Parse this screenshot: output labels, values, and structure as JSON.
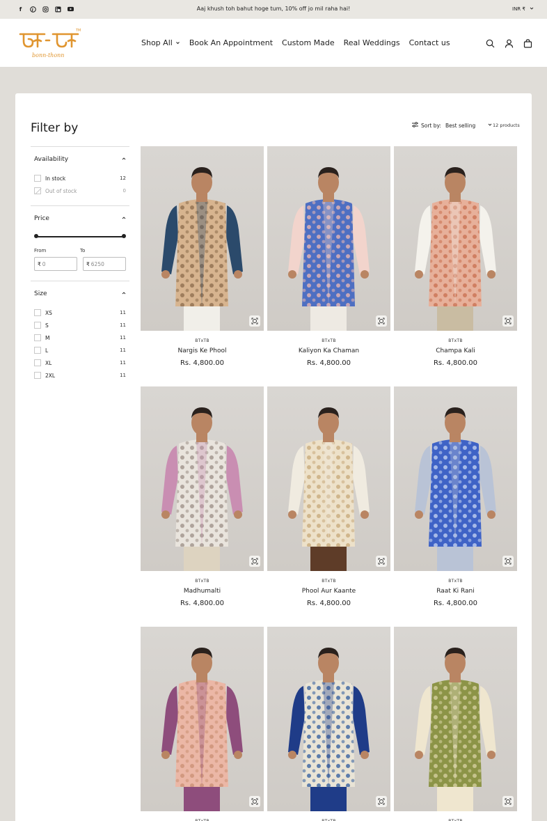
{
  "topbar": {
    "socials": [
      "facebook-icon",
      "pinterest-icon",
      "instagram-icon",
      "linkedin-icon",
      "youtube-icon"
    ],
    "announcement": "Aaj khush toh bahut hoge tum, 10% off jo mil raha hai!",
    "currency": "INR ₹"
  },
  "header": {
    "logo_text": "bonn-thonn",
    "logo_mark": "TM",
    "nav": [
      "Shop All",
      "Book An Appointment",
      "Custom Made",
      "Real Weddings",
      "Contact us"
    ],
    "icons": [
      "search-icon",
      "account-icon",
      "cart-icon"
    ]
  },
  "colors": {
    "logo_orange": "#e0952f",
    "page_bg": "#e0ddd8",
    "topbar_bg": "#e9e7e2"
  },
  "collection": {
    "filter_title": "Filter by",
    "sort_label": "Sort by:",
    "sort_value": "Best selling",
    "product_count": "12 products"
  },
  "filters": {
    "availability": {
      "title": "Availability",
      "options": [
        {
          "label": "In stock",
          "count": "12",
          "disabled": false
        },
        {
          "label": "Out of stock",
          "count": "0",
          "disabled": true
        }
      ]
    },
    "price": {
      "title": "Price",
      "from_label": "From",
      "to_label": "To",
      "currency_symbol": "₹",
      "from_placeholder": "0",
      "to_placeholder": "6250"
    },
    "size": {
      "title": "Size",
      "options": [
        {
          "label": "XS",
          "count": "11"
        },
        {
          "label": "S",
          "count": "11"
        },
        {
          "label": "M",
          "count": "11"
        },
        {
          "label": "L",
          "count": "11"
        },
        {
          "label": "XL",
          "count": "11"
        },
        {
          "label": "2XL",
          "count": "11"
        }
      ]
    }
  },
  "products": [
    {
      "vendor": "BTxTB",
      "name": "Nargis Ke Phool",
      "price": "Rs. 4,800.00",
      "jacket": "#d7b48f",
      "pattern": "#8a6b4a",
      "sleeve": "#2b4a6b",
      "pant": "#f1efe9"
    },
    {
      "vendor": "BTxTB",
      "name": "Kaliyon Ka Chaman",
      "price": "Rs. 4,800.00",
      "jacket": "#4e6fc2",
      "pattern": "#f0b9b0",
      "sleeve": "#f2d4cc",
      "pant": "#eeeae3"
    },
    {
      "vendor": "BTxTB",
      "name": "Champa Kali",
      "price": "Rs. 4,800.00",
      "jacket": "#e7b09a",
      "pattern": "#c86f4f",
      "sleeve": "#f4f2ec",
      "pant": "#c9bca2"
    },
    {
      "vendor": "BTxTB",
      "name": "Madhumalti",
      "price": "Rs. 4,800.00",
      "jacket": "#e9e4dd",
      "pattern": "#9a8d85",
      "sleeve": "#c98eb2",
      "pant": "#ddd3c0"
    },
    {
      "vendor": "BTxTB",
      "name": "Phool Aur Kaante",
      "price": "Rs. 4,800.00",
      "jacket": "#ede1c9",
      "pattern": "#c7a878",
      "sleeve": "#f0ebe0",
      "pant": "#5e3c28"
    },
    {
      "vendor": "BTxTB",
      "name": "Raat Ki Rani",
      "price": "Rs. 4,800.00",
      "jacket": "#3f63c6",
      "pattern": "#c9d6f2",
      "sleeve": "#b9c3d6",
      "pant": "#b9c3d6"
    },
    {
      "vendor": "BTxTB",
      "name": "",
      "price": "",
      "jacket": "#ebb7a6",
      "pattern": "#c98f73",
      "sleeve": "#8e4d7c",
      "pant": "#8e4d7c"
    },
    {
      "vendor": "BTxTB",
      "name": "",
      "price": "",
      "jacket": "#e9e4d6",
      "pattern": "#2f5a9c",
      "sleeve": "#1f3c88",
      "pant": "#1f3c88"
    },
    {
      "vendor": "BTxTB",
      "name": "",
      "price": "",
      "jacket": "#8c9447",
      "pattern": "#d9d3a4",
      "sleeve": "#efe6cf",
      "pant": "#efe6cf"
    }
  ]
}
